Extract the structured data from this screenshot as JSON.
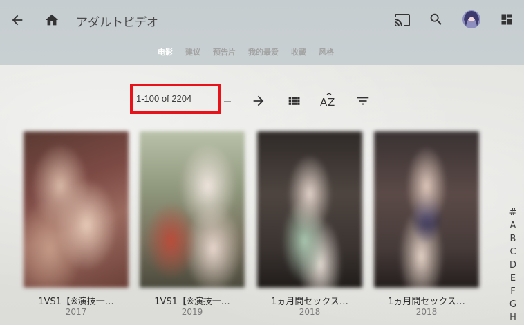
{
  "header": {
    "title": "アダルトビデオ",
    "icons": {
      "back": "back-arrow-icon",
      "home": "home-icon",
      "cast": "cast-icon",
      "search": "search-icon",
      "avatar": "user-avatar",
      "dashboard": "dashboard-icon"
    }
  },
  "tabs": [
    {
      "label": "电影",
      "active": true
    },
    {
      "label": "建议",
      "active": false
    },
    {
      "label": "预告片",
      "active": false
    },
    {
      "label": "我的最爱",
      "active": false
    },
    {
      "label": "收藏",
      "active": false
    },
    {
      "label": "风格",
      "active": false
    }
  ],
  "toolbar": {
    "range": "1-100 of 2204",
    "highlight_color": "#e8121a"
  },
  "items": [
    {
      "title": "1VS1【※演技一…",
      "year": "2017"
    },
    {
      "title": "1VS1【※演技一…",
      "year": "2019"
    },
    {
      "title": "1ヵ月間セックス…",
      "year": "2018"
    },
    {
      "title": "1ヵ月間セックス…",
      "year": "2018"
    }
  ],
  "alphabet": [
    "#",
    "A",
    "B",
    "C",
    "D",
    "E",
    "F",
    "G",
    "H"
  ],
  "colors": {
    "header_bg": "#c6cdd0",
    "active_tab": "#ffffff",
    "inactive_tab": "#a3a3a3"
  }
}
